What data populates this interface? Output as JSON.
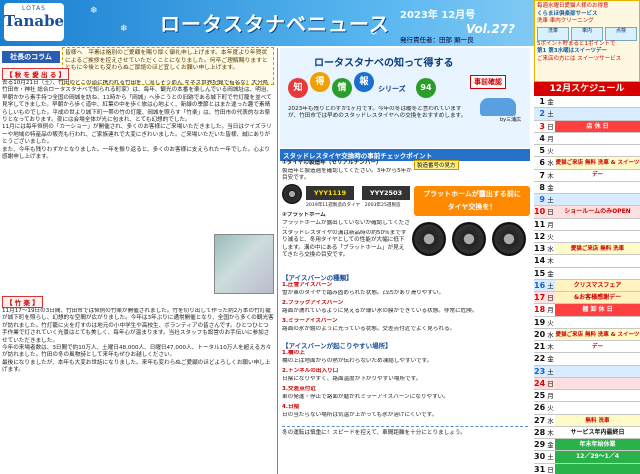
{
  "header": {
    "logo_small": "LOTAS",
    "logo_big": "Tanabe",
    "title": "ロータスタナベニュース",
    "issue": "2023年 12月号",
    "vol": "Vol.27?",
    "publisher": "発行責任者：田部 顕一良",
    "colors": {
      "header_bg": "#1a7fd1",
      "accent": "#d60000",
      "banner": "#2570c9"
    }
  },
  "promo": {
    "line1": "毎週水曜日愛猫人様のお得意",
    "line2": "くらまほ倶楽部サービス",
    "line3": "洗車 車内クリーニング",
    "line4": "5ポイント貯まると1ポイントで",
    "line5": "第1 第3水曜はスイーツデー",
    "line6": "ご来店の方には スイーツサービス",
    "shops": [
      "洗車",
      "車内",
      "点検"
    ]
  },
  "president": {
    "label": "社長のコラム",
    "greeting": "皆様へ　平素は格別のご愛顧を賜り厚く御礼申し上げます。本年度より年賀状によるご挨拶を控えさせていただくことになりました。何卒ご理解賜りますとともに今後とも変わらぬご厚誼のほど宜しくお願い申し上げます。",
    "autumn_heading": "【 秋 を 愛 出 る 】",
    "autumn_text": "去る10月21日（土）、竹田のどこの道に携われる竹田を（ 流しそうめん ギネス世界記録で有名な）大分県 竹田市・神社 総合ロータスタナベで知られる町家）は、毎年、観光の本番を楽しんでいる岡城址は、明治、早朝かから素手持つ全国の岡城を訪ね、11時から「岡城」へ歩こうとの旧跡である城下町で竹灯籠を並べて見学してきました。早朝から歩く道中、紅葉の中を歩く旅は心地よく、新緑の季節とはまた違った趣で素晴らしいものでした。平成の世より城下町一帯の竹の灯籠、岡城を照らす「竹楽」は、竹田市の代表的なお祭りとなっております。夜には会場全体が光に包まれ、とても幻想的でした。\n11月には毎年恒例の「カーショー」が開催され、多くのお客様にご来場いただきました。当日はクイズラリーや地域の特産品の販売も行われ、ご家族連れで大変にぎわいました。ご来場いただいた皆様、誠にありがとうございました。\nまた、今年も残りわずかとなりました。一年を振り返ると、多くのお客様に支えられた一年でした。心より感謝申し上げます。",
    "chikuraku_heading": "【 竹 楽 】",
    "chikuraku_text": "11月17〜19日の3日間、竹田市では恒例の竹楽が開催されました。竹を切り出して作った約2万本の竹灯籠が城下町を照らし、幻想的な空間が広がりました。今年は3年ぶりに通常開催となり、全国から多くの観光客が訪れました。竹灯籠に火を灯すのは地元の小中学生や高校生、ボランティアの皆さんです。ひとつひとつ手作業で灯されていく光景はとても美しく、毎年心が温まります。当社スタッフも設営のお手伝いに参加させていただきました。\n今年の来場者数は、3日間で約10万人、土曜日48,000人、日曜日47,000人、トータル10万人を超える方々が訪れました。竹田の冬の風物詩として来年もぜひお越しください。\n最後になりましたが、本年も大変お世話になりました。来年も変わらぬご愛顧のほどよろしくお願い申し上げます。",
    "photo_caption": "竹楽の様子"
  },
  "tips": {
    "title": "ロータスタナベの知って得する",
    "chars": [
      "知",
      "得",
      "情",
      "報"
    ],
    "series": "シリーズ",
    "series_no": "94",
    "jiko": "事前確認",
    "by": "by三浦広",
    "intro": "2023年も残りとわずか1ヶ月です。今年の冬は暖冬と言われていますが、竹田市では早めのスタッドレスタイヤへの交換をおすすめします。",
    "banner1": "スタッドレスタイヤ交換時の事前チェックポイント",
    "check1": "①タイヤの製造年（セリアルナンバー）",
    "check1_desc": "製造年と製造週を確認してください。3年から5年が目安です。",
    "date_label": "製造番号の見方",
    "serial1": "YYY1119",
    "serial2": "YYY2503",
    "serial_note": "2019年11週製造のタイヤ　2003年25週製造",
    "check2": "②プラットホーム",
    "check2_desc": "プラットホームが露出していないか確認してください。",
    "platform_alert1": "プラットホームが露出する前に",
    "platform_alert2": "タイヤ交換を！",
    "check2_body": "スタッドレスタイヤの溝は新品時の約50％まですり減ると、冬用タイヤとしての性能が大幅に低下します。溝の中にある「プラットホーム」が見えてきたら交換の目安です。",
    "ice_heading": "【アイスバーンの種類】",
    "ice1": "1.圧雪アイスバーン",
    "ice1_desc": "雪が車のタイヤで踏み固められた状態。凸凹があり滑りやすい。",
    "ice2": "2.ブラックアイスバーン",
    "ice2_desc": "路面が濡れているように見えるが薄い氷の膜ができている状態。非常に危険。",
    "ice3": "3.ミラーアイスバーン",
    "ice3_desc": "路面の氷が鏡のように光っている状態。交差点付近でよく見られる。",
    "danger_heading": "【アイスバーンが起こりやすい場所】",
    "danger1": "1.橋の上",
    "danger1_desc": "橋の上は地面からの熱が伝わらないため凍結しやすいです。",
    "danger2": "2.トンネルの出入り口",
    "danger2_desc": "日陰になりやすく、路面温度が下がりやすい場所です。",
    "danger3": "3.交差点付近",
    "danger3_desc": "車の発進・停止で路面が磨かれミラーアイスバーンになりやすい。",
    "danger4": "4.日陰",
    "danger4_desc": "日の当たらない場所は気温が上がっても氷が溶けにくいです。",
    "closing": "冬の運転は慎重に！スピードを控えて、車間距離を十分にとりましょう。"
  },
  "schedule": {
    "header": "12月スケジュール",
    "rows": [
      {
        "d": "1",
        "w": "金",
        "ev": "",
        "t": "normal"
      },
      {
        "d": "2",
        "w": "土",
        "ev": "",
        "t": "sat"
      },
      {
        "d": "3",
        "w": "日",
        "ev": "店 休 日",
        "t": "hol"
      },
      {
        "d": "4",
        "w": "月",
        "ev": "",
        "t": "normal"
      },
      {
        "d": "5",
        "w": "火",
        "ev": "",
        "t": "normal"
      },
      {
        "d": "6",
        "w": "水",
        "ev": "愛猫ご来店 無料 洗車 & スイーツデー",
        "t": "wash"
      },
      {
        "d": "7",
        "w": "木",
        "ev": "",
        "t": "normal"
      },
      {
        "d": "8",
        "w": "金",
        "ev": "",
        "t": "normal"
      },
      {
        "d": "9",
        "w": "土",
        "ev": "",
        "t": "sat"
      },
      {
        "d": "10",
        "w": "日",
        "ev": "ショールームのみOPEN",
        "t": "sun"
      },
      {
        "d": "11",
        "w": "月",
        "ev": "",
        "t": "normal"
      },
      {
        "d": "12",
        "w": "火",
        "ev": "",
        "t": "normal"
      },
      {
        "d": "13",
        "w": "水",
        "ev": "愛猫ご来店 無料 洗車",
        "t": "wash"
      },
      {
        "d": "14",
        "w": "木",
        "ev": "",
        "t": "normal"
      },
      {
        "d": "15",
        "w": "金",
        "ev": "",
        "t": "normal"
      },
      {
        "d": "16",
        "w": "土",
        "ev": "クリスマスフェア",
        "t": "sat"
      },
      {
        "d": "17",
        "w": "日",
        "ev": "&お客様感謝デー",
        "t": "sun"
      },
      {
        "d": "18",
        "w": "月",
        "ev": "棚 卸 休 日",
        "t": "hol"
      },
      {
        "d": "19",
        "w": "火",
        "ev": "",
        "t": "normal"
      },
      {
        "d": "20",
        "w": "水",
        "ev": "愛猫ご来店 無料 洗車 & スイーツデー",
        "t": "wash"
      },
      {
        "d": "21",
        "w": "木",
        "ev": "",
        "t": "normal"
      },
      {
        "d": "22",
        "w": "金",
        "ev": "",
        "t": "normal"
      },
      {
        "d": "23",
        "w": "土",
        "ev": "",
        "t": "sat"
      },
      {
        "d": "24",
        "w": "日",
        "ev": "",
        "t": "sun"
      },
      {
        "d": "25",
        "w": "月",
        "ev": "",
        "t": "normal"
      },
      {
        "d": "26",
        "w": "火",
        "ev": "",
        "t": "normal"
      },
      {
        "d": "27",
        "w": "水",
        "ev": "無料 洗車",
        "t": "wash"
      },
      {
        "d": "28",
        "w": "木",
        "ev": "サービス年内最終日",
        "t": "normal"
      },
      {
        "d": "29",
        "w": "金",
        "ev": "年末年始休業",
        "t": "closed"
      },
      {
        "d": "30",
        "w": "土",
        "ev": "12／29〜1／4",
        "t": "closed"
      },
      {
        "d": "31",
        "w": "日",
        "ev": "",
        "t": "closed"
      }
    ]
  }
}
